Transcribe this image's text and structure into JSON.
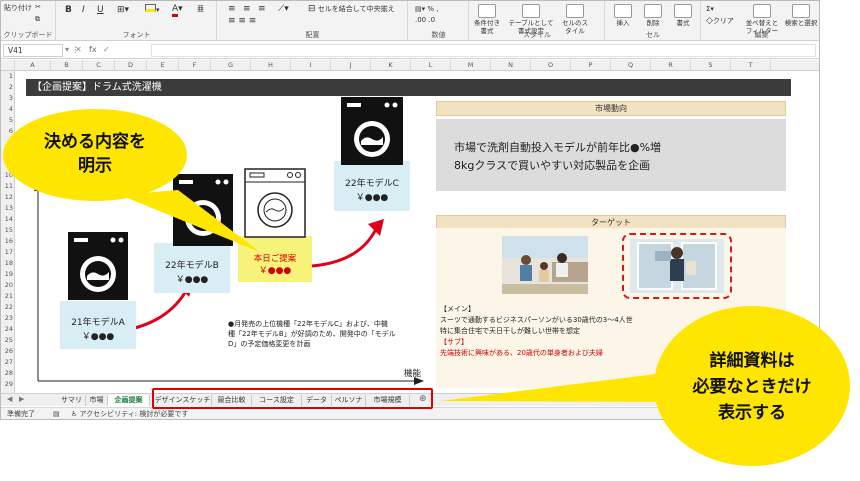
{
  "ribbon": {
    "paste_label": "貼り付け",
    "clipboard_label": "クリップボード",
    "font_label": "フォント",
    "alignment_label": "配置",
    "merge_center_label": "セルを結合して中央揃え",
    "number_label": "数値",
    "conditional_format_label": "条件付き書式",
    "format_as_table_label": "テーブルとして書式設定",
    "cell_styles_label": "セルのスタイル",
    "styles_label": "スタイル",
    "insert_label": "挿入",
    "delete_label": "削除",
    "format_label": "書式",
    "cells_label": "セル",
    "clear_label": "クリア",
    "sort_filter_label": "並べ替えとフィルター",
    "find_select_label": "検索と選択",
    "editing_label": "編集",
    "bold_label": "B",
    "italic_label": "I",
    "underline_label": "U",
    "fill_label": "A"
  },
  "formula_bar": {
    "name_box": "V41",
    "fx_label": "fx",
    "value": ""
  },
  "columns": [
    "A",
    "B",
    "C",
    "D",
    "E",
    "F",
    "G",
    "H",
    "I",
    "J",
    "K",
    "L",
    "M",
    "N",
    "O",
    "P",
    "Q",
    "R",
    "S",
    "T"
  ],
  "rows": [
    "1",
    "2",
    "3",
    "4",
    "5",
    "6",
    "7",
    "8",
    "9",
    "10",
    "11",
    "12",
    "13",
    "14",
    "15",
    "16",
    "17",
    "18",
    "19",
    "20",
    "21",
    "22",
    "23",
    "24",
    "25",
    "26",
    "27",
    "28",
    "29"
  ],
  "sheet": {
    "title": "【企画提案】ドラム式洗濯機",
    "model_a": {
      "name": "21年モデルA",
      "price": "￥●●●"
    },
    "model_b": {
      "name": "22年モデルB",
      "price": "￥●●●"
    },
    "model_c": {
      "name": "22年モデルC",
      "price": "￥●●●"
    },
    "proposal": {
      "name": "本日ご提案",
      "price": "￥●●●"
    },
    "note_lines": [
      "●月発売の上位機種「22年モデルC」および、中機",
      "種「22年モデルB」が好調のため、開発中の「モデル",
      "D」の予定価格変更を計画"
    ],
    "axis_label": "機能",
    "market": {
      "heading": "市場動向",
      "lines": [
        "市場で洗剤自動投入モデルが前年比●%増",
        "8kgクラスで買いやすい対応製品を企画"
      ]
    },
    "target": {
      "heading": "ターゲット",
      "main_tag": "【メイン】",
      "main_lines": [
        "スーツで通勤するビジネスパーソンがいる30歳代の3～4人世",
        "特に集合住宅で天日干しが難しい世帯を想定"
      ],
      "sub_tag": "【サブ】",
      "sub_line": "先端技術に興味がある、20歳代の単身者および夫婦"
    }
  },
  "tabs": [
    {
      "label": "サマリ",
      "active": false
    },
    {
      "label": "市場",
      "active": false
    },
    {
      "label": "企画提案",
      "active": true
    },
    {
      "label": "デザインスケッチ",
      "active": false
    },
    {
      "label": "競合比較",
      "active": false
    },
    {
      "label": "コース設定",
      "active": false
    },
    {
      "label": "データ",
      "active": false
    },
    {
      "label": "ペルソナ",
      "active": false
    },
    {
      "label": "市場規模",
      "active": false
    }
  ],
  "status": {
    "ready": "準備完了",
    "accessibility": "アクセシビリティ: 検討が必要です"
  },
  "callouts": {
    "top_left": [
      "決める内容を",
      "明示"
    ],
    "bottom_right": [
      "詳細資料は",
      "必要なときだけ",
      "表示する"
    ]
  },
  "colors": {
    "callout_yellow": "#ffe600",
    "highlight_red": "#e00000",
    "arrow_red": "#e0001b",
    "title_bar": "#3b3b3b",
    "washer_box": "#d9edf5",
    "proposal_box": "#f6f27a"
  }
}
